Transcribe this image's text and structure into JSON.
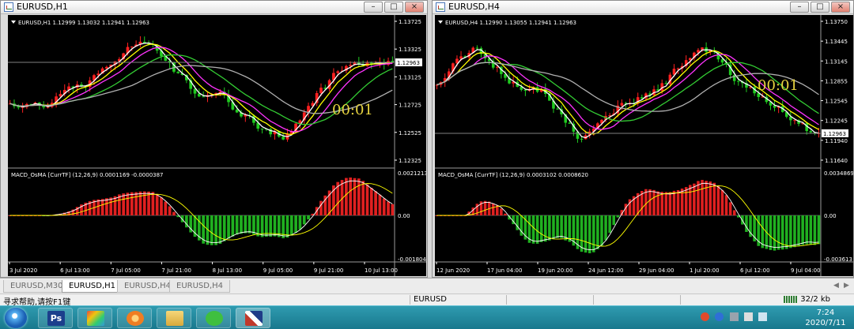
{
  "windows": [
    {
      "title": "EURUSD,H1",
      "info": "EURUSD,H1  1.12999 1.13032 1.12941 1.12963",
      "timer": "00:01",
      "price_ticks": [
        "1.13725",
        "1.13325",
        "1.13125",
        "1.12725",
        "1.12525",
        "1.12325"
      ],
      "current_price": "1.12963",
      "macd_label": "MACD_OsMA [CurrTF] (12,26,9) 0.0001169 -0.0000387",
      "macd_ticks": [
        "0.0021213",
        "0.00",
        "-0.001804"
      ],
      "dates": [
        "3 Jul 2020",
        "6 Jul 13:00",
        "7 Jul 05:00",
        "7 Jul 21:00",
        "8 Jul 13:00",
        "9 Jul 05:00",
        "9 Jul 21:00",
        "10 Jul 13:00"
      ]
    },
    {
      "title": "EURUSD,H4",
      "info": "EURUSD,H4  1.12990 1.13055 1.12941 1.12963",
      "timer": "00:01",
      "price_ticks": [
        "1.13750",
        "1.13445",
        "1.13145",
        "1.12855",
        "1.12545",
        "1.12245",
        "1.11940",
        "1.11640"
      ],
      "current_price": "1.12963",
      "macd_label": "MACD_OsMA [CurrTF] (12,26,9) 0.0003102 0.0008620",
      "macd_ticks": [
        "0.0034869",
        "0.00",
        "-0.003613"
      ],
      "dates": [
        "12 Jun 2020",
        "17 Jun 04:00",
        "19 Jun 20:00",
        "24 Jun 12:00",
        "29 Jun 04:00",
        "1 Jul 20:00",
        "6 Jul 12:00",
        "9 Jul 04:00"
      ]
    }
  ],
  "tabs": [
    {
      "label": "EURUSD,M30",
      "active": false
    },
    {
      "label": "EURUSD,H1",
      "active": true
    },
    {
      "label": "EURUSD,H4",
      "active": false
    },
    {
      "label": "EURUSD,H4",
      "active": false
    }
  ],
  "status": {
    "help": "寻求帮助,请按F1键",
    "symbol": "EURUSD",
    "traffic": "32/2 kb"
  },
  "taskbar": {
    "apps": [
      {
        "name": "photoshop",
        "label": "Ps",
        "color": "#1c3f8c"
      },
      {
        "name": "paint-app",
        "label": "",
        "color": "#e0a23a"
      },
      {
        "name": "browser-app",
        "label": "",
        "color": "#ef7d22"
      },
      {
        "name": "file-explorer",
        "label": "",
        "color": "#e8c25a"
      },
      {
        "name": "wechat",
        "label": "",
        "color": "#3fbf3f"
      },
      {
        "name": "metatrader",
        "label": "",
        "color": "#c0392b"
      }
    ],
    "time": "7:24",
    "date": "2020/7/11"
  },
  "colors": {
    "background": "#000000",
    "bull_candle": "#ff2020",
    "bear_candle": "#20cc20",
    "ma_white": "#ffffff",
    "ma_yellow": "#ffff00",
    "ma_magenta": "#ff33ff",
    "ma_green": "#33cc33",
    "ma_gray": "#b0b0b0",
    "timer": "#e8d440",
    "macd_pos": "#e02020",
    "macd_neg": "#20b020"
  }
}
